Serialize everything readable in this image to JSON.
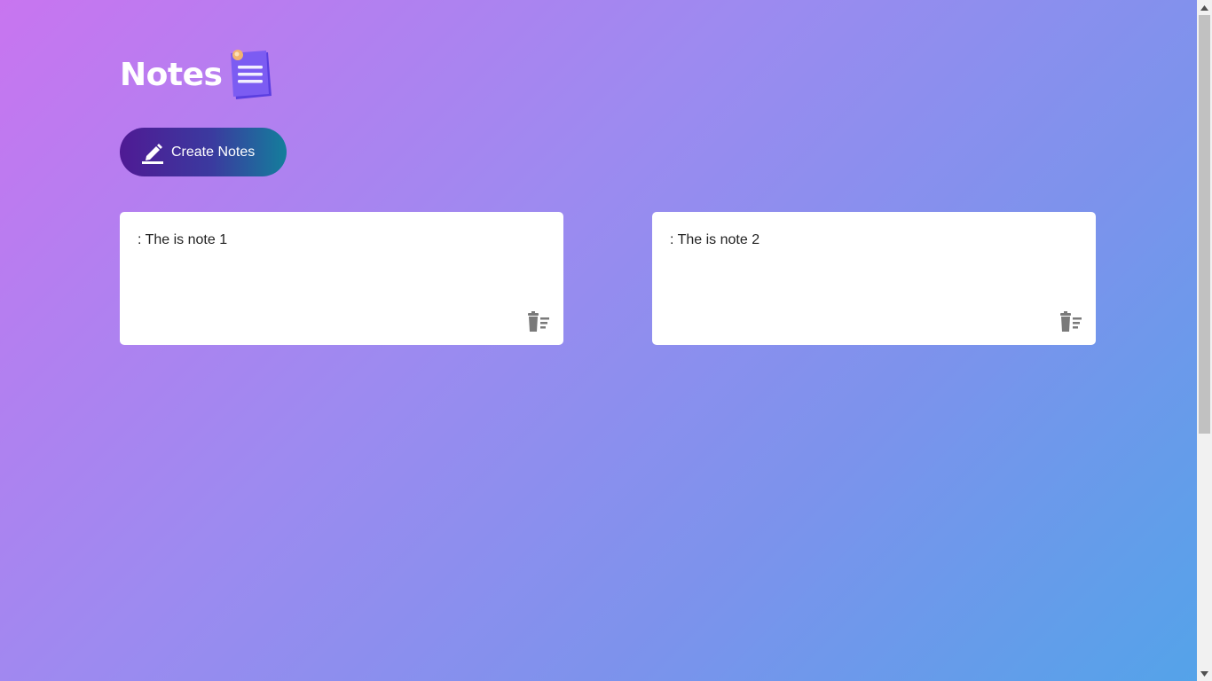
{
  "header": {
    "title": "Notes",
    "logo_icon": "notes-logo-icon"
  },
  "create_button": {
    "label": "Create Notes",
    "icon": "pen-icon"
  },
  "notes": [
    {
      "text": ": The is note 1",
      "delete_icon": "trash-icon"
    },
    {
      "text": ": The is note 2",
      "delete_icon": "trash-icon"
    }
  ],
  "colors": {
    "background_start": "#c875f0",
    "background_end": "#54a3e9",
    "button_start": "#4f1a94",
    "button_end": "#147e9c",
    "card": "#ffffff",
    "trash": "#7a7a7a"
  }
}
